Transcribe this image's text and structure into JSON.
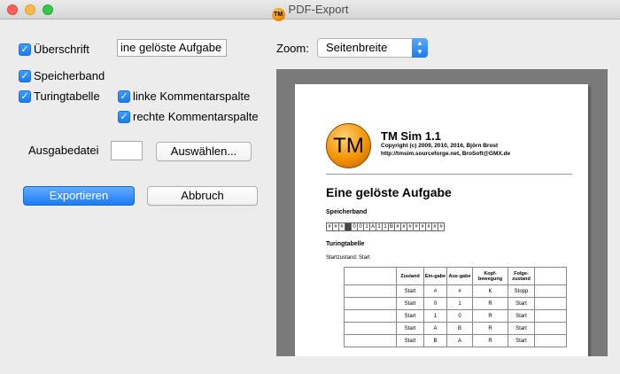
{
  "window": {
    "title": "PDF-Export",
    "icon_text": "TM"
  },
  "options": {
    "ueberschrift": {
      "label": "Überschrift",
      "checked": true
    },
    "speicherband": {
      "label": "Speicherband",
      "checked": true
    },
    "turingtabelle": {
      "label": "Turingtabelle",
      "checked": true
    },
    "linke": {
      "label": "linke Kommentarspalte",
      "checked": true
    },
    "rechte": {
      "label": "rechte Kommentarspalte",
      "checked": true
    }
  },
  "heading_field": {
    "value": "ine gelöste Aufgabe"
  },
  "output": {
    "label": "Ausgabedatei",
    "value": "",
    "choose_label": "Auswählen..."
  },
  "actions": {
    "export_label": "Exportieren",
    "cancel_label": "Abbruch"
  },
  "zoom": {
    "label": "Zoom:",
    "selected": "Seitenbreite"
  },
  "preview": {
    "logo_text": "TM",
    "title": "TM Sim 1.1",
    "copyright": "Copyright (c) 2009, 2010, 2016, Björn Brost",
    "url": "http://tmsim.sourceforge.net, BroSoft@GMX.de",
    "heading": "Eine gelöste Aufgabe",
    "tape_heading": "Speicherband",
    "tape": [
      "#",
      "#",
      "#",
      "",
      "0",
      "0",
      "1",
      "A",
      "1",
      "1",
      "B",
      "#",
      "#",
      "#",
      "#",
      "#",
      "#",
      "#",
      "#"
    ],
    "table_heading": "Turingtabelle",
    "start_label": "Startzustand: Start",
    "columns": [
      "Zustand",
      "Ein-gabe",
      "Aus-gabe",
      "Kopf-bewegung",
      "Folge-zustand"
    ],
    "rows": [
      [
        "Start",
        "#",
        "#",
        "K",
        "Stopp"
      ],
      [
        "Start",
        "0",
        "1",
        "R",
        "Start"
      ],
      [
        "Start",
        "1",
        "0",
        "R",
        "Start"
      ],
      [
        "Start",
        "A",
        "B",
        "R",
        "Start"
      ],
      [
        "Start",
        "B",
        "A",
        "R",
        "Start"
      ]
    ]
  },
  "colors": {
    "accent": "#1a7cf5",
    "preview_bg": "#7a7a7a",
    "logo": "#f49300"
  }
}
